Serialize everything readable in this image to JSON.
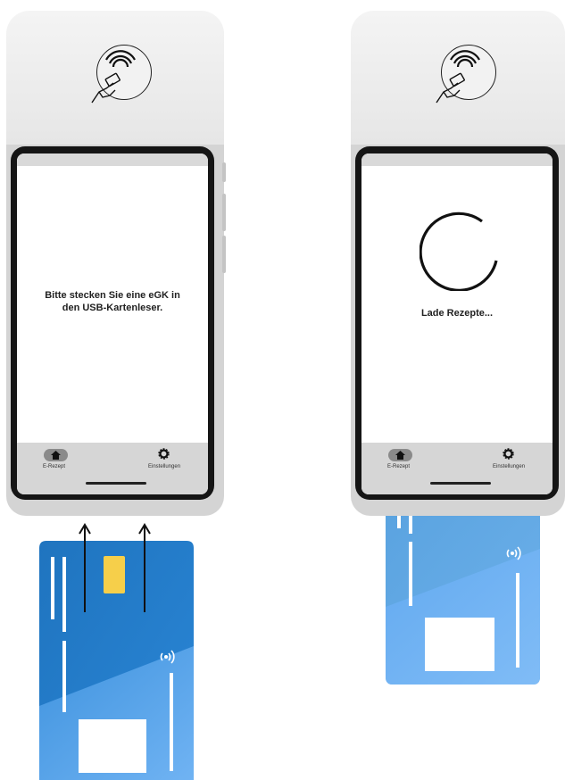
{
  "screens": {
    "insert": {
      "message": "Bitte stecken Sie eine eGK in den USB-Kartenleser."
    },
    "loading": {
      "message": "Lade Rezepte..."
    }
  },
  "nav": {
    "home_label": "E-Rezept",
    "settings_label": "Einstellungen"
  },
  "icons": {
    "nfc_tap": "hand-tap-nfc-icon",
    "home": "home-icon",
    "settings": "gear-icon",
    "contactless": "contactless-icon",
    "spinner": "loading-spinner-icon",
    "arrow": "arrow-up-icon"
  },
  "colors": {
    "card_blue_dark": "#1e78c5",
    "card_blue_light": "#62a9ef",
    "chip": "#f6cf4a",
    "device_body": "#d4d4d4",
    "bezel": "#151515"
  }
}
